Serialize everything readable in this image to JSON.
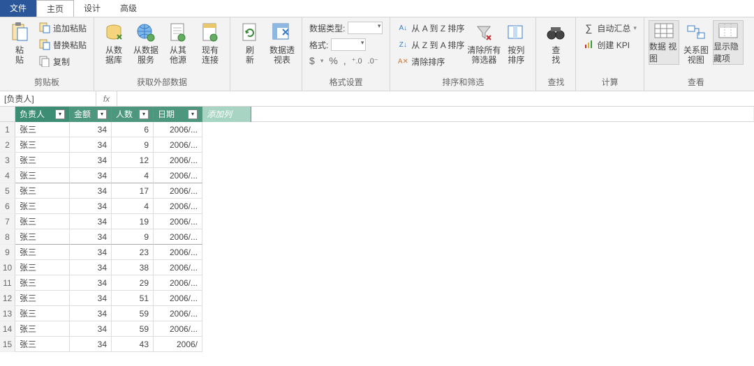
{
  "tabs": {
    "file": "文件",
    "home": "主页",
    "design": "设计",
    "advanced": "高级"
  },
  "ribbon": {
    "clipboard": {
      "label": "剪贴板",
      "paste": "粘\n贴",
      "append": "追加粘贴",
      "replace": "替换粘贴",
      "copy": "复制"
    },
    "external": {
      "label": "获取外部数据",
      "db": "从数\n据库",
      "svc": "从数据\n服务",
      "other": "从其\n他源",
      "conn": "现有\n连接"
    },
    "refresh": {
      "label": "",
      "refresh": "刷\n新",
      "pivot": "数据透\n视表"
    },
    "format": {
      "label": "格式设置",
      "datatype": "数据类型:",
      "format": "格式:",
      "sym1": "$",
      "sym2": "%",
      "sym3": ",",
      "sym4": ".0₀",
      "sym5": ".0⁰"
    },
    "sort": {
      "label": "排序和筛选",
      "az": "从 A 到 Z 排序",
      "za": "从 Z 到 A 排序",
      "clear": "清除排序",
      "clearfilter": "清除所有\n筛选器",
      "bycol": "按列\n排序"
    },
    "find": {
      "label": "查找",
      "find": "查\n找"
    },
    "calc": {
      "label": "计算",
      "autosum": "自动汇总",
      "kpi": "创建 KPI"
    },
    "view": {
      "label": "查看",
      "data": "数据\n视图",
      "diagram": "关系图\n视图",
      "hidden": "显示隐\n藏项"
    }
  },
  "formula": {
    "name": "[负责人]",
    "fx": "fx"
  },
  "columns": {
    "c1": "负责人",
    "c2": "金额",
    "c3": "人数",
    "c4": "日期",
    "add": "添加列"
  },
  "rows": [
    {
      "n": "1",
      "c1": "张三",
      "c2": "34",
      "c3": "6",
      "c4": "2006/..."
    },
    {
      "n": "2",
      "c1": "张三",
      "c2": "34",
      "c3": "9",
      "c4": "2006/..."
    },
    {
      "n": "3",
      "c1": "张三",
      "c2": "34",
      "c3": "12",
      "c4": "2006/..."
    },
    {
      "n": "4",
      "c1": "张三",
      "c2": "34",
      "c3": "4",
      "c4": "2006/..."
    },
    {
      "n": "5",
      "c1": "张三",
      "c2": "34",
      "c3": "17",
      "c4": "2006/..."
    },
    {
      "n": "6",
      "c1": "张三",
      "c2": "34",
      "c3": "4",
      "c4": "2006/..."
    },
    {
      "n": "7",
      "c1": "张三",
      "c2": "34",
      "c3": "19",
      "c4": "2006/..."
    },
    {
      "n": "8",
      "c1": "张三",
      "c2": "34",
      "c3": "9",
      "c4": "2006/..."
    },
    {
      "n": "9",
      "c1": "张三",
      "c2": "34",
      "c3": "23",
      "c4": "2006/..."
    },
    {
      "n": "10",
      "c1": "张三",
      "c2": "34",
      "c3": "38",
      "c4": "2006/..."
    },
    {
      "n": "11",
      "c1": "张三",
      "c2": "34",
      "c3": "29",
      "c4": "2006/..."
    },
    {
      "n": "12",
      "c1": "张三",
      "c2": "34",
      "c3": "51",
      "c4": "2006/..."
    },
    {
      "n": "13",
      "c1": "张三",
      "c2": "34",
      "c3": "59",
      "c4": "2006/..."
    },
    {
      "n": "14",
      "c1": "张三",
      "c2": "34",
      "c3": "59",
      "c4": "2006/..."
    },
    {
      "n": "15",
      "c1": "张三",
      "c2": "34",
      "c3": "43",
      "c4": "2006/"
    }
  ]
}
